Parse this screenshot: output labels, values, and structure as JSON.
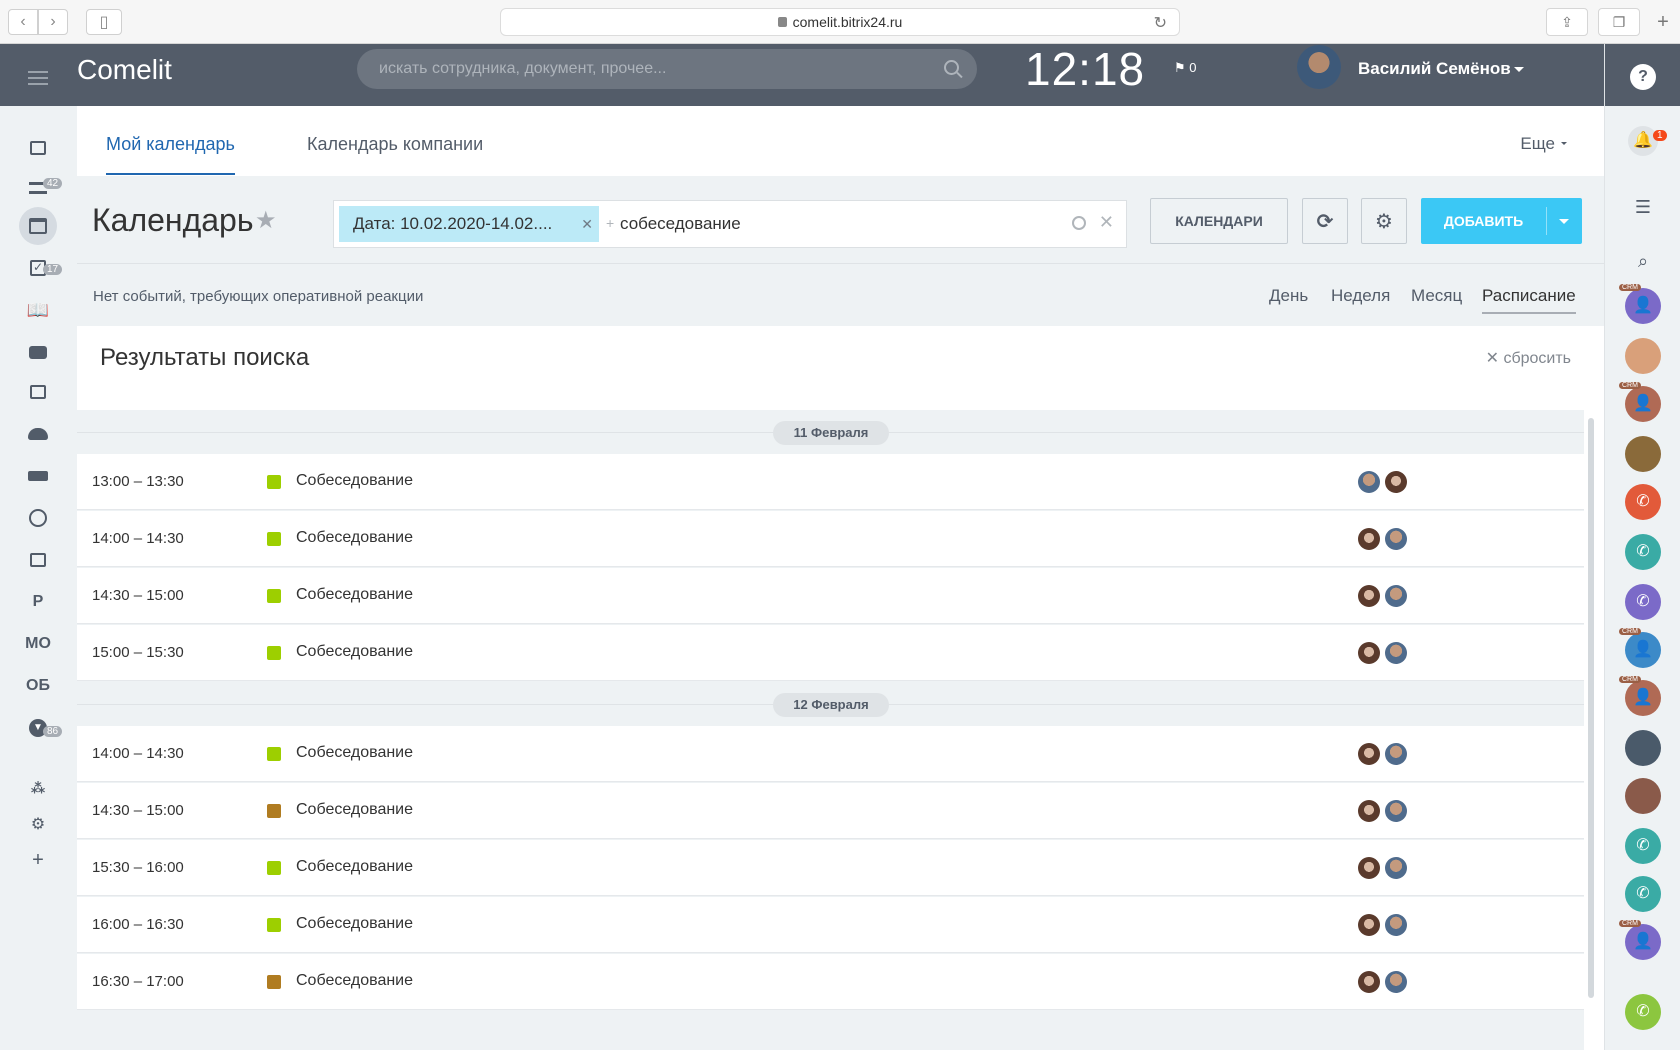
{
  "browser": {
    "url": "comelit.bitrix24.ru"
  },
  "header": {
    "logo": "Comelit",
    "search_placeholder": "искать сотрудника, документ, прочее...",
    "clock": "12:18",
    "flag_count": "0",
    "user_name": "Василий Семёнов"
  },
  "sidebar": {
    "badges": {
      "filter": "42",
      "tasks": "17",
      "more": "86"
    },
    "text_items": [
      "P",
      "МО",
      "ОБ"
    ]
  },
  "tabs": {
    "my_calendar": "Мой календарь",
    "company_calendar": "Календарь компании",
    "more": "Еще"
  },
  "toolbar": {
    "title": "Календарь",
    "filter_chip": "Дата: 10.02.2020-14.02....",
    "filter_text": "собеседование",
    "calendars_btn": "КАЛЕНДАРИ",
    "add_btn": "ДОБАВИТЬ"
  },
  "status": {
    "text": "Нет событий, требующих оперативной реакции",
    "views": [
      "День",
      "Неделя",
      "Месяц",
      "Расписание"
    ],
    "active_view": "Расписание"
  },
  "results": {
    "title": "Результаты поиска",
    "reset": "сбросить",
    "days": [
      {
        "label": "11 Февраля",
        "events": [
          {
            "time": "13:00 – 13:30",
            "name": "Собеседование",
            "color": "#9dcf00"
          },
          {
            "time": "14:00 – 14:30",
            "name": "Собеседование",
            "color": "#9dcf00"
          },
          {
            "time": "14:30 – 15:00",
            "name": "Собеседование",
            "color": "#9dcf00"
          },
          {
            "time": "15:00 – 15:30",
            "name": "Собеседование",
            "color": "#9dcf00"
          }
        ]
      },
      {
        "label": "12 Февраля",
        "events": [
          {
            "time": "14:00 – 14:30",
            "name": "Собеседование",
            "color": "#9dcf00"
          },
          {
            "time": "14:30 – 15:00",
            "name": "Собеседование",
            "color": "#b07c21"
          },
          {
            "time": "15:30 – 16:00",
            "name": "Собеседование",
            "color": "#9dcf00"
          },
          {
            "time": "16:00 – 16:30",
            "name": "Собеседование",
            "color": "#9dcf00"
          },
          {
            "time": "16:30 – 17:00",
            "name": "Собеседование",
            "color": "#b07c21"
          }
        ]
      }
    ]
  },
  "right_panel": {
    "notification_count": "1",
    "crm_label": "CRM"
  }
}
